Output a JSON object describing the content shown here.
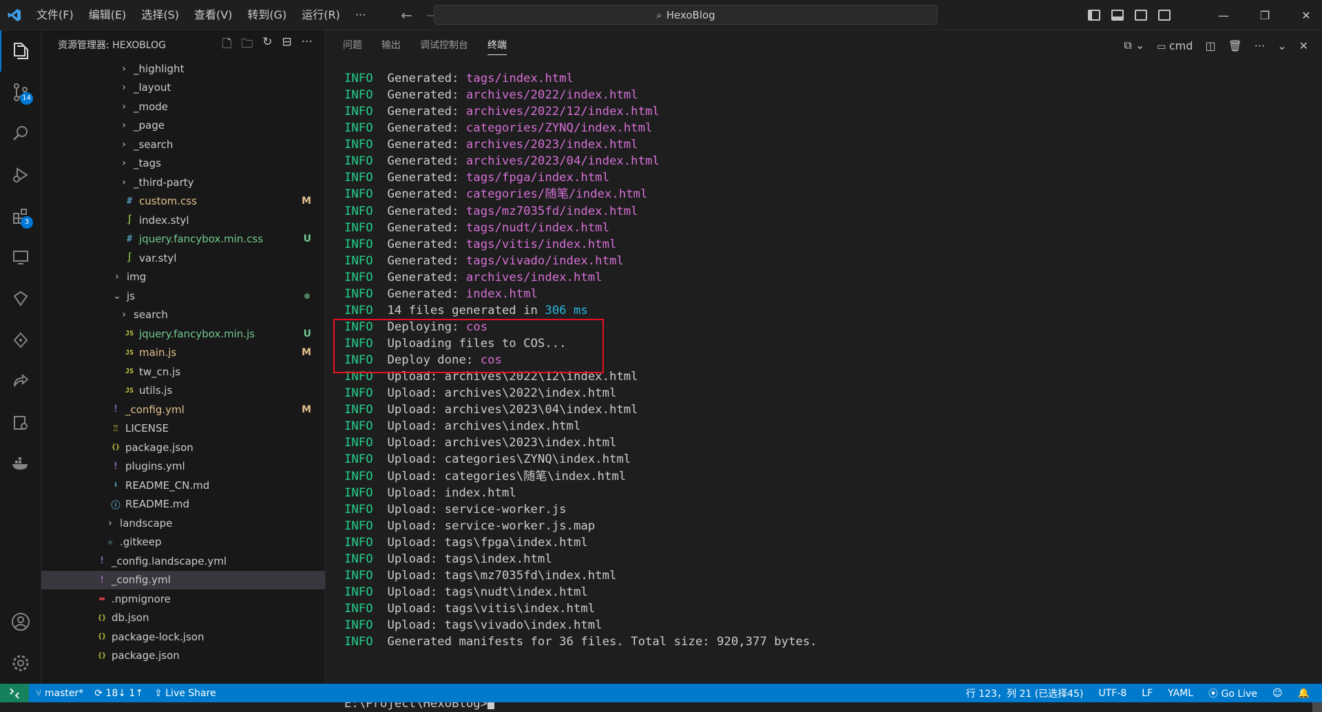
{
  "titlebar": {
    "menu": [
      "文件(F)",
      "编辑(E)",
      "选择(S)",
      "查看(V)",
      "转到(G)",
      "运行(R)",
      "···"
    ],
    "search": "HexoBlog",
    "accent": "#0078d4"
  },
  "activity": {
    "scm_badge": "14",
    "extensions_badge": "3"
  },
  "sidebar": {
    "title": "资源管理器: HEXOBLOG",
    "tree": [
      {
        "label": "_highlight",
        "type": "folder",
        "indent": 52
      },
      {
        "label": "_layout",
        "type": "folder",
        "indent": 52
      },
      {
        "label": "_mode",
        "type": "folder",
        "indent": 52
      },
      {
        "label": "_page",
        "type": "folder",
        "indent": 52
      },
      {
        "label": "_search",
        "type": "folder",
        "indent": 52
      },
      {
        "label": "_tags",
        "type": "folder",
        "indent": 52
      },
      {
        "label": "_third-party",
        "type": "folder",
        "indent": 52
      },
      {
        "label": "custom.css",
        "type": "css",
        "indent": 60,
        "status": "M"
      },
      {
        "label": "index.styl",
        "type": "styl",
        "indent": 60
      },
      {
        "label": "jquery.fancybox.min.css",
        "type": "css",
        "indent": 60,
        "status": "U"
      },
      {
        "label": "var.styl",
        "type": "styl",
        "indent": 60
      },
      {
        "label": "img",
        "type": "folder",
        "indent": 42
      },
      {
        "label": "js",
        "type": "folder-open",
        "indent": 42,
        "dot": true
      },
      {
        "label": "search",
        "type": "folder",
        "indent": 52
      },
      {
        "label": "jquery.fancybox.min.js",
        "type": "js",
        "indent": 60,
        "status": "U"
      },
      {
        "label": "main.js",
        "type": "js",
        "indent": 60,
        "status": "M"
      },
      {
        "label": "tw_cn.js",
        "type": "js",
        "indent": 60
      },
      {
        "label": "utils.js",
        "type": "js",
        "indent": 60
      },
      {
        "label": "_config.yml",
        "type": "yml",
        "indent": 40,
        "status": "M"
      },
      {
        "label": "LICENSE",
        "type": "license",
        "indent": 40
      },
      {
        "label": "package.json",
        "type": "json",
        "indent": 40
      },
      {
        "label": "plugins.yml",
        "type": "yml",
        "indent": 40
      },
      {
        "label": "README_CN.md",
        "type": "md",
        "indent": 40
      },
      {
        "label": "README.md",
        "type": "info",
        "indent": 40
      },
      {
        "label": "landscape",
        "type": "folder",
        "indent": 32
      },
      {
        "label": ".gitkeep",
        "type": "git",
        "indent": 32
      },
      {
        "label": "_config.landscape.yml",
        "type": "yml",
        "indent": 20
      },
      {
        "label": "_config.yml",
        "type": "yml",
        "indent": 20,
        "selected": true
      },
      {
        "label": ".npmignore",
        "type": "npm",
        "indent": 20
      },
      {
        "label": "db.json",
        "type": "json",
        "indent": 20
      },
      {
        "label": "package-lock.json",
        "type": "json",
        "indent": 20
      },
      {
        "label": "package.json",
        "type": "json",
        "indent": 20
      }
    ]
  },
  "panel": {
    "tabs": [
      "问题",
      "输出",
      "调试控制台",
      "终端"
    ],
    "active_tab": 3,
    "terminal_name": "cmd"
  },
  "terminal": {
    "lines": [
      {
        "tag": "INFO",
        "text": "Generated: ",
        "value": "tags/index.html",
        "vcolor": "mag"
      },
      {
        "tag": "INFO",
        "text": "Generated: ",
        "value": "archives/2022/index.html",
        "vcolor": "mag"
      },
      {
        "tag": "INFO",
        "text": "Generated: ",
        "value": "archives/2022/12/index.html",
        "vcolor": "mag"
      },
      {
        "tag": "INFO",
        "text": "Generated: ",
        "value": "categories/ZYNQ/index.html",
        "vcolor": "mag"
      },
      {
        "tag": "INFO",
        "text": "Generated: ",
        "value": "archives/2023/index.html",
        "vcolor": "mag"
      },
      {
        "tag": "INFO",
        "text": "Generated: ",
        "value": "archives/2023/04/index.html",
        "vcolor": "mag"
      },
      {
        "tag": "INFO",
        "text": "Generated: ",
        "value": "tags/fpga/index.html",
        "vcolor": "mag"
      },
      {
        "tag": "INFO",
        "text": "Generated: ",
        "value": "categories/随笔/index.html",
        "vcolor": "mag"
      },
      {
        "tag": "INFO",
        "text": "Generated: ",
        "value": "tags/mz7035fd/index.html",
        "vcolor": "mag"
      },
      {
        "tag": "INFO",
        "text": "Generated: ",
        "value": "tags/nudt/index.html",
        "vcolor": "mag"
      },
      {
        "tag": "INFO",
        "text": "Generated: ",
        "value": "tags/vitis/index.html",
        "vcolor": "mag"
      },
      {
        "tag": "INFO",
        "text": "Generated: ",
        "value": "tags/vivado/index.html",
        "vcolor": "mag"
      },
      {
        "tag": "INFO",
        "text": "Generated: ",
        "value": "archives/index.html",
        "vcolor": "mag"
      },
      {
        "tag": "INFO",
        "text": "Generated: ",
        "value": "index.html",
        "vcolor": "mag"
      },
      {
        "tag": "INFO",
        "text": "14 files generated in ",
        "value": "306 ms",
        "vcolor": "cyan"
      },
      {
        "tag": "INFO",
        "text": "Deploying: ",
        "value": "cos",
        "vcolor": "mag"
      },
      {
        "tag": "INFO",
        "text": "Uploading files to COS...",
        "value": "",
        "vcolor": ""
      },
      {
        "tag": "INFO",
        "text": "Deploy done: ",
        "value": "cos",
        "vcolor": "mag"
      },
      {
        "tag": "INFO",
        "text": "Upload: archives\\2022\\12\\index.html",
        "value": "",
        "vcolor": ""
      },
      {
        "tag": "INFO",
        "text": "Upload: archives\\2022\\index.html",
        "value": "",
        "vcolor": ""
      },
      {
        "tag": "INFO",
        "text": "Upload: archives\\2023\\04\\index.html",
        "value": "",
        "vcolor": ""
      },
      {
        "tag": "INFO",
        "text": "Upload: archives\\index.html",
        "value": "",
        "vcolor": ""
      },
      {
        "tag": "INFO",
        "text": "Upload: archives\\2023\\index.html",
        "value": "",
        "vcolor": ""
      },
      {
        "tag": "INFO",
        "text": "Upload: categories\\ZYNQ\\index.html",
        "value": "",
        "vcolor": ""
      },
      {
        "tag": "INFO",
        "text": "Upload: categories\\随笔\\index.html",
        "value": "",
        "vcolor": ""
      },
      {
        "tag": "INFO",
        "text": "Upload: index.html",
        "value": "",
        "vcolor": ""
      },
      {
        "tag": "INFO",
        "text": "Upload: service-worker.js",
        "value": "",
        "vcolor": ""
      },
      {
        "tag": "INFO",
        "text": "Upload: service-worker.js.map",
        "value": "",
        "vcolor": ""
      },
      {
        "tag": "INFO",
        "text": "Upload: tags\\fpga\\index.html",
        "value": "",
        "vcolor": ""
      },
      {
        "tag": "INFO",
        "text": "Upload: tags\\index.html",
        "value": "",
        "vcolor": ""
      },
      {
        "tag": "INFO",
        "text": "Upload: tags\\mz7035fd\\index.html",
        "value": "",
        "vcolor": ""
      },
      {
        "tag": "INFO",
        "text": "Upload: tags\\nudt\\index.html",
        "value": "",
        "vcolor": ""
      },
      {
        "tag": "INFO",
        "text": "Upload: tags\\vitis\\index.html",
        "value": "",
        "vcolor": ""
      },
      {
        "tag": "INFO",
        "text": "Upload: tags\\vivado\\index.html",
        "value": "",
        "vcolor": ""
      },
      {
        "tag": "INFO",
        "text": "Generated manifests for 36 files. Total size: 920,377 bytes.",
        "value": "",
        "vcolor": ""
      }
    ],
    "prompt": "E:\\Project\\HexoBlog>"
  },
  "statusbar": {
    "branch": "master*",
    "sync": "18↓ 1↑",
    "live_share": "Live Share",
    "position": "行 123，列 21 (已选择45)",
    "encoding": "UTF-8",
    "eol": "LF",
    "language": "YAML",
    "go_live": "Go Live",
    "bg_color": "#007acc"
  }
}
